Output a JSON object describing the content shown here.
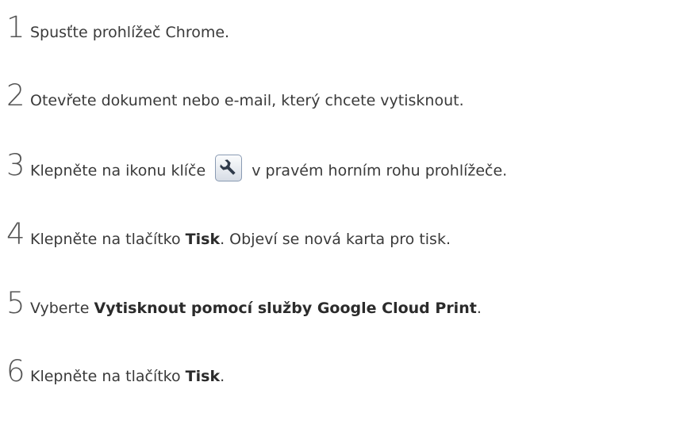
{
  "steps": [
    {
      "number": "1",
      "text": "Spusťte prohlížeč Chrome."
    },
    {
      "number": "2",
      "text": "Otevřete dokument nebo e-mail, který chcete vytisknout."
    },
    {
      "number": "3",
      "text_before": "Klepněte na ikonu klíče",
      "icon": "wrench-icon",
      "text_after": "v pravém horním rohu prohlížeče."
    },
    {
      "number": "4",
      "text_before": "Klepněte na tlačítko ",
      "bold": "Tisk",
      "text_after": ". Objeví se nová karta pro tisk."
    },
    {
      "number": "5",
      "text_before": "Vyberte ",
      "bold": "Vytisknout pomocí služby Google Cloud Print",
      "text_after": "."
    },
    {
      "number": "6",
      "text_before": "Klepněte na tlačítko ",
      "bold": "Tisk",
      "text_after": "."
    }
  ],
  "colors": {
    "text": "#3a3a3a",
    "number": "#555555",
    "icon_border": "#8a9bb3",
    "icon_glyph": "#2f3a4a"
  }
}
